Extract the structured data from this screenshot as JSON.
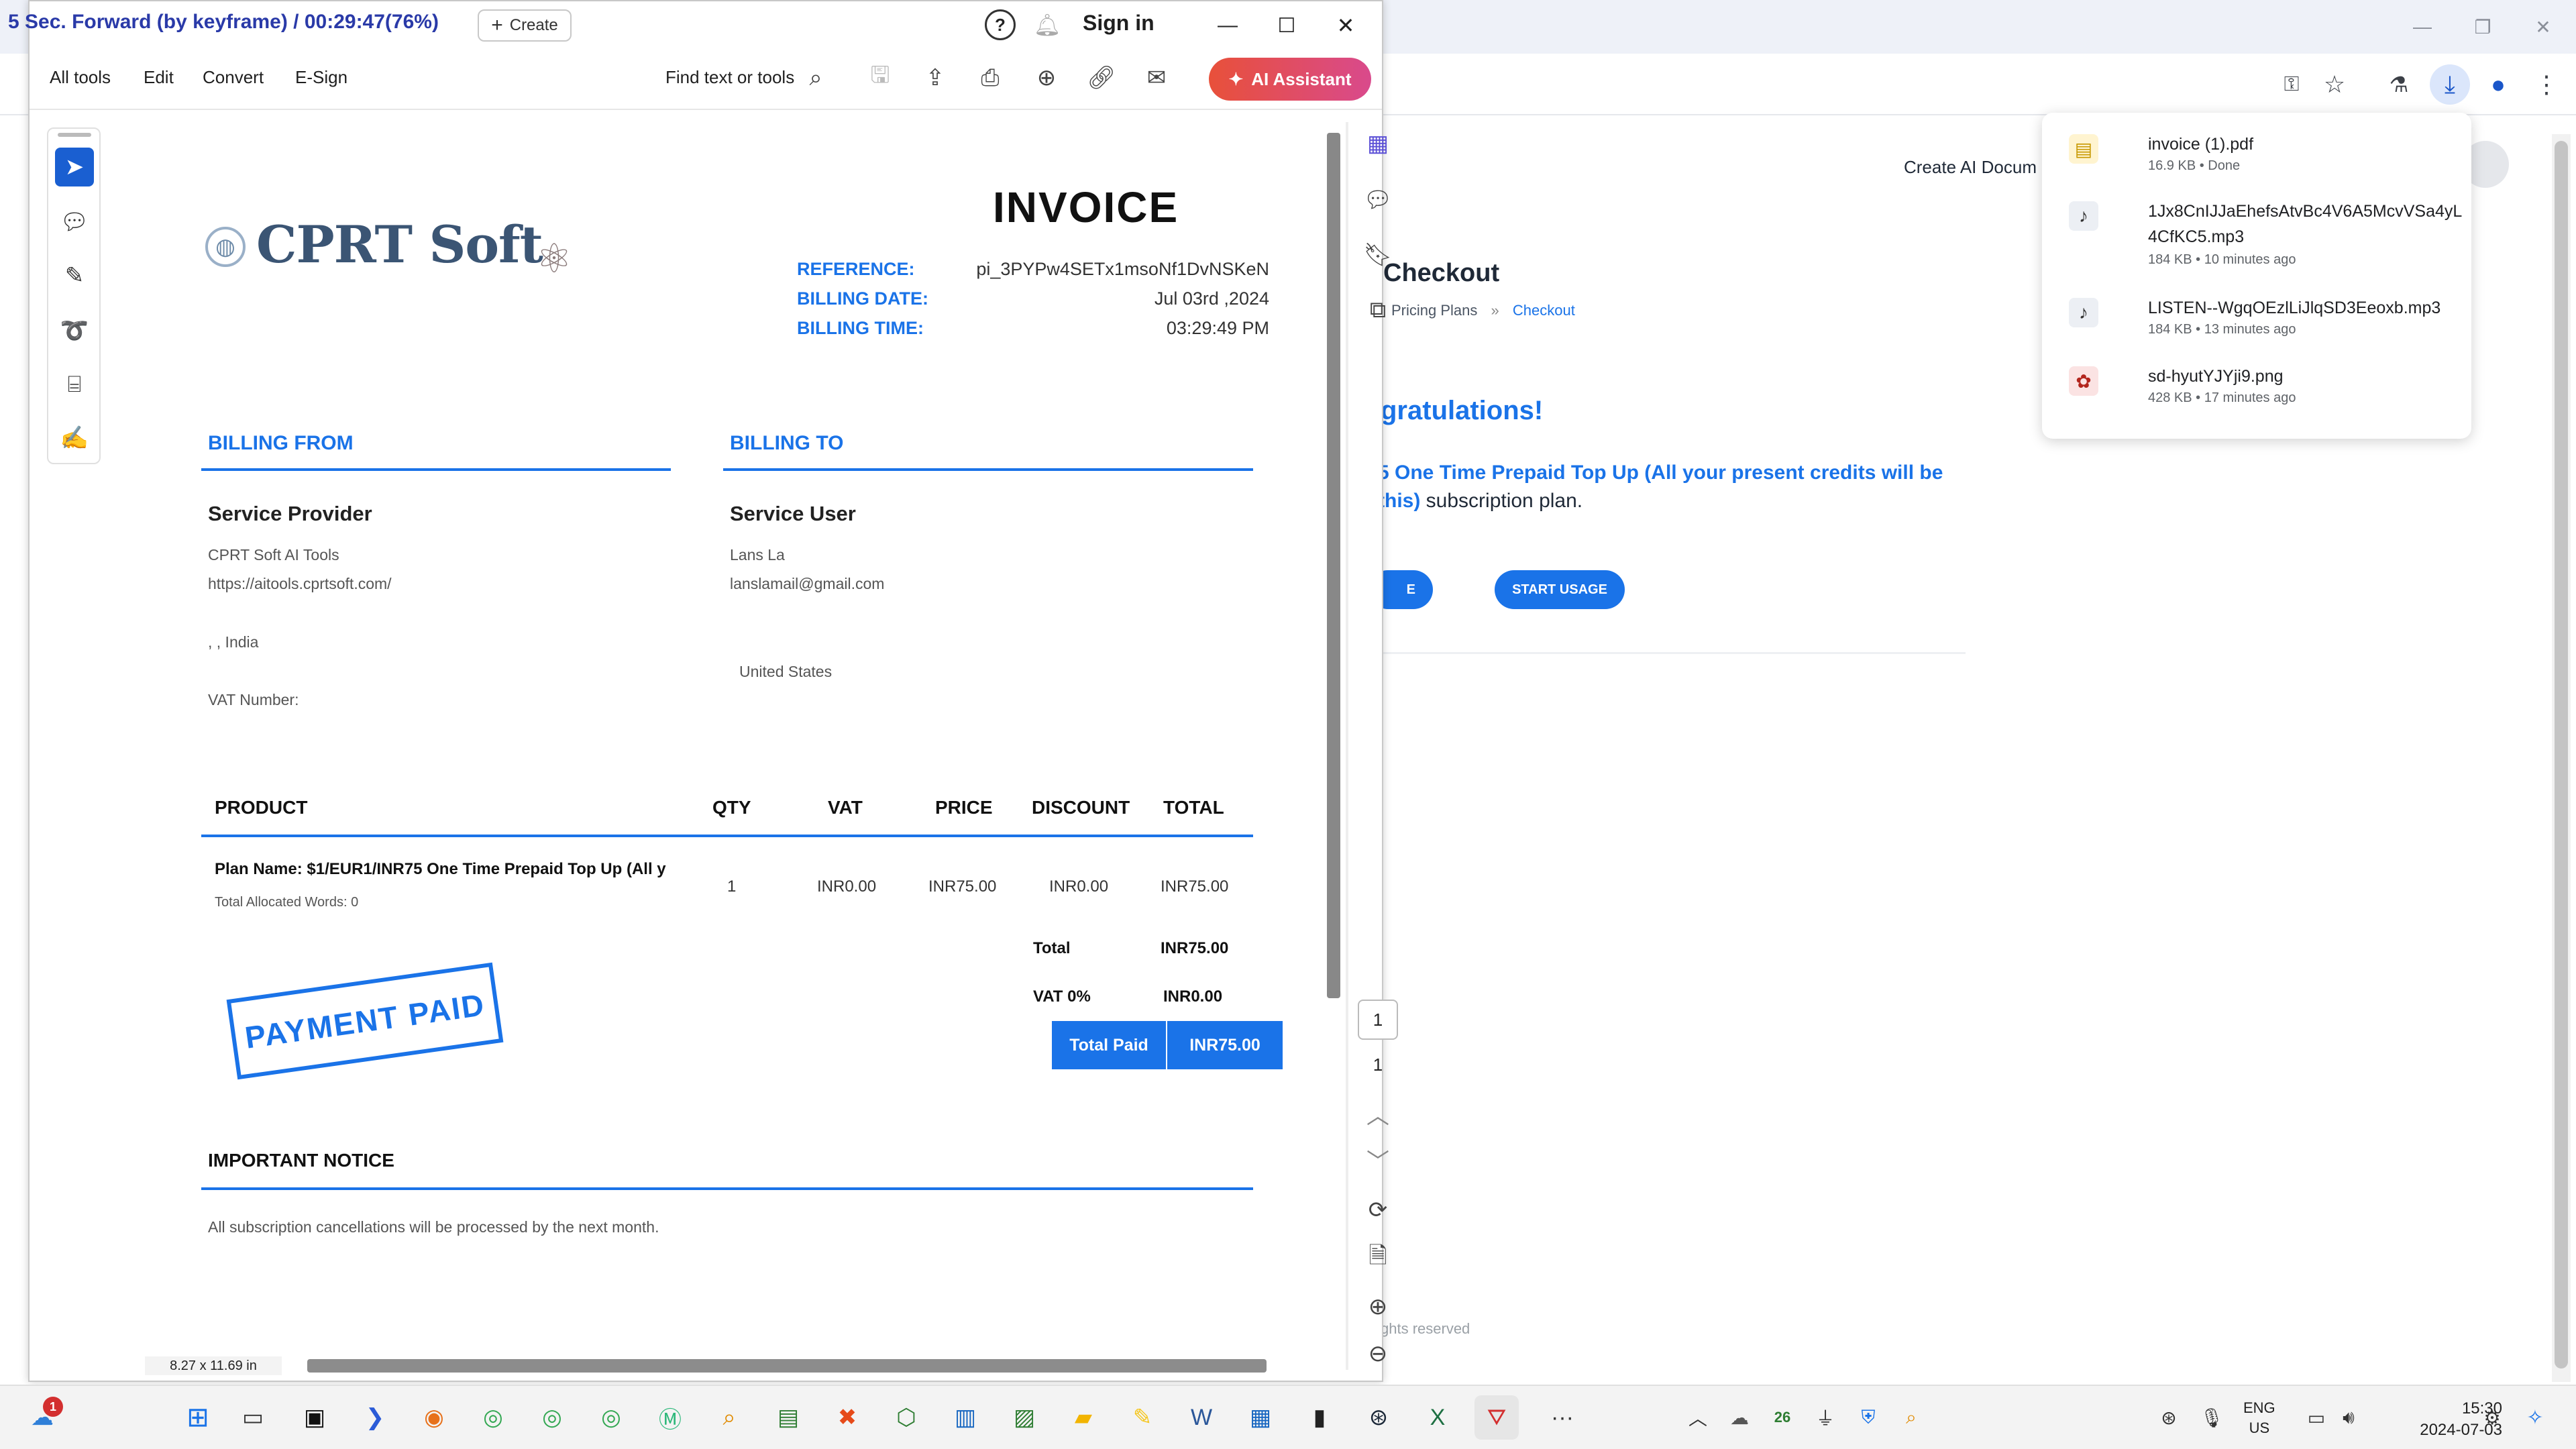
{
  "recording_overlay": "5 Sec. Forward (by keyframe) / 00:29:47(76%)",
  "browser": {
    "create_ai_doc": "Create AI Docum",
    "page_title": "Checkout",
    "breadcrumb": [
      "Pricing Plans",
      "»",
      "Checkout"
    ],
    "congrats": "gratulations!",
    "plan_line1": "5 One Time Prepaid Top Up (All your present credits will be",
    "plan_line2_bold": "this)",
    "plan_line2_rest": " subscription plan.",
    "btn_left": "E",
    "btn_start": "START USAGE",
    "rights": "ghts reserved"
  },
  "downloads": [
    {
      "name": "invoice (1).pdf",
      "meta": "16.9 KB • Done",
      "icon": "pdf-file-icon"
    },
    {
      "name": "1Jx8CnIJJaEhefsAtvBc4V6A5McvVSa4yL4CfKC5.mp3",
      "meta": "184 KB • 10 minutes ago",
      "icon": "audio-file-icon"
    },
    {
      "name": "LISTEN--WgqOEzlLiJlqSD3Eeoxb.mp3",
      "meta": "184 KB • 13 minutes ago",
      "icon": "audio-file-icon"
    },
    {
      "name": "sd-hyutYJYji9.png",
      "meta": "428 KB • 17 minutes ago",
      "icon": "image-file-icon"
    }
  ],
  "acrobat": {
    "create": "Create",
    "sign_in": "Sign in",
    "menus": [
      "All tools",
      "Edit",
      "Convert",
      "E-Sign"
    ],
    "find": "Find text or tools",
    "ai_assistant": "AI Assistant",
    "page_number": "1",
    "page_count": "1",
    "page_size": "8.27 x 11.69 in"
  },
  "invoice": {
    "logo_text": "CPRT Soft",
    "title": "INVOICE",
    "reference_label": "REFERENCE:",
    "reference": "pi_3PYPw4SETx1msoNf1DvNSKeN",
    "billing_date_label": "BILLING DATE:",
    "billing_date": "Jul 03rd ,2024",
    "billing_time_label": "BILLING TIME:",
    "billing_time": "03:29:49 PM",
    "from_heading": "BILLING FROM",
    "to_heading": "BILLING TO",
    "from_title": "Service Provider",
    "from_name": "CPRT Soft AI Tools",
    "from_url": "https://aitools.cprtsoft.com/",
    "from_country": ", , India",
    "vat_number": "VAT Number:",
    "to_title": "Service User",
    "to_name": "Lans La",
    "to_email": "lanslamail@gmail.com",
    "to_country": "United States",
    "columns": [
      "PRODUCT",
      "QTY",
      "VAT",
      "PRICE",
      "DISCOUNT",
      "TOTAL"
    ],
    "item": {
      "product": "Plan Name: $1/EUR1/INR75 One Time Prepaid Top Up (All y",
      "sub": "Total Allocated Words: 0",
      "qty": "1",
      "vat": "INR0.00",
      "price": "INR75.00",
      "discount": "INR0.00",
      "total": "INR75.00"
    },
    "total_label": "Total",
    "total_value": "INR75.00",
    "vat_label": "VAT 0%",
    "vat_value": "INR0.00",
    "total_paid_label": "Total Paid",
    "total_paid_value": "INR75.00",
    "stamp": "PAYMENT PAID",
    "notice_heading": "IMPORTANT NOTICE",
    "notice_text": "All subscription cancellations will be processed by the next month."
  },
  "taskbar": {
    "notif_badge": "1",
    "lang": "ENG",
    "region": "US",
    "time": "15:30",
    "date": "2024-07-03",
    "calendar_day": "26"
  }
}
